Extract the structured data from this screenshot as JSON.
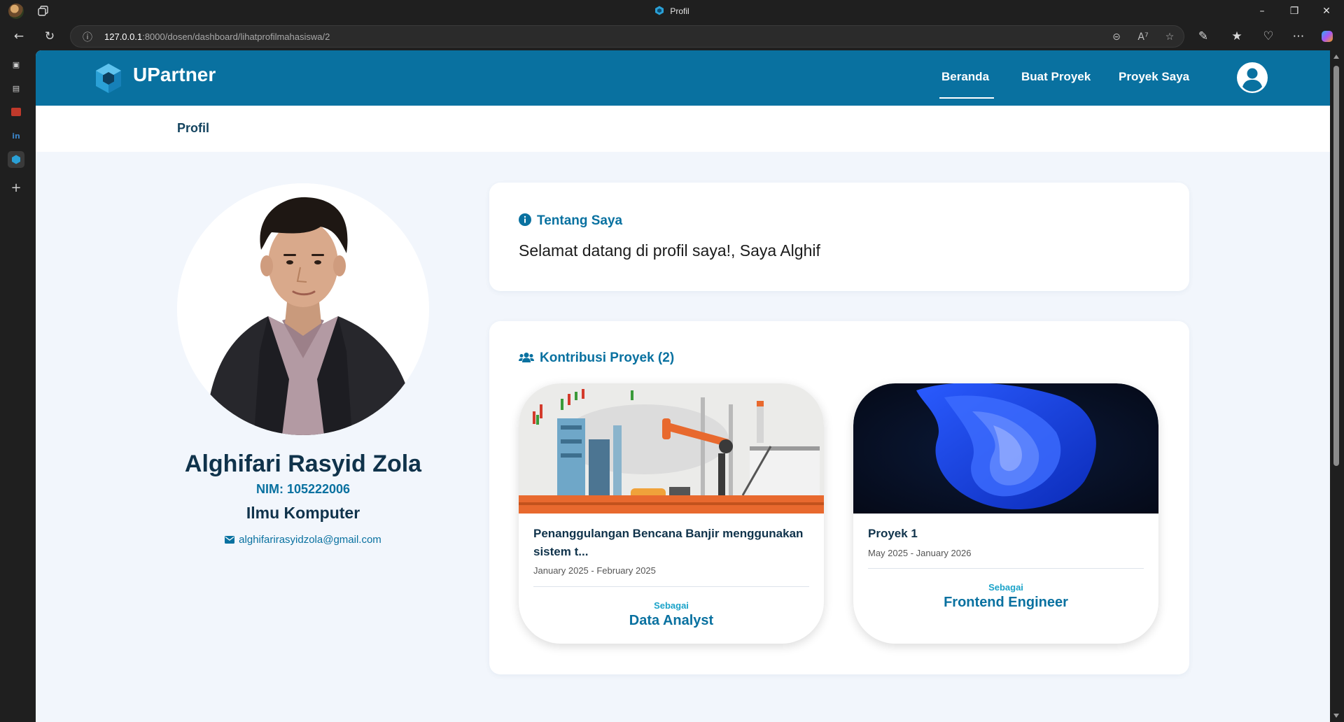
{
  "browser": {
    "tab_title": "Profil",
    "url_host": "127.0.0.1",
    "url_path": ":8000/dosen/dashboard/lihatprofilmahasiswa/2"
  },
  "sidebar_icons": [
    "tabs-icon",
    "collections-icon",
    "app-icon",
    "linkedin-icon",
    "upartner-icon",
    "add-icon"
  ],
  "site": {
    "brand": "UPartner",
    "nav": [
      {
        "label": "Beranda",
        "active": true
      },
      {
        "label": "Buat Proyek",
        "active": false
      },
      {
        "label": "Proyek Saya",
        "active": false
      }
    ],
    "page_title": "Profil",
    "colors": {
      "primary": "#0971a0",
      "dark": "#10334b",
      "accent": "#1ba3c9",
      "background": "#f2f6fc"
    }
  },
  "profile": {
    "name": "Alghifari Rasyid Zola",
    "nim": "NIM: 105222006",
    "major": "Ilmu Komputer",
    "email": "alghifarirasyidzola@gmail.com"
  },
  "about": {
    "heading": "Tentang Saya",
    "text": "Selamat datang di profil saya!, Saya Alghif"
  },
  "projects": {
    "heading": "Kontribusi Proyek (2)",
    "items": [
      {
        "title": "Penanggulangan Bencana Banjir menggunakan sistem t...",
        "date": "January 2025 - February 2025",
        "as_label": "Sebagai",
        "role": "Data Analyst"
      },
      {
        "title": "Proyek 1",
        "date": "May 2025 - January 2026",
        "as_label": "Sebagai",
        "role": "Frontend Engineer"
      }
    ]
  }
}
